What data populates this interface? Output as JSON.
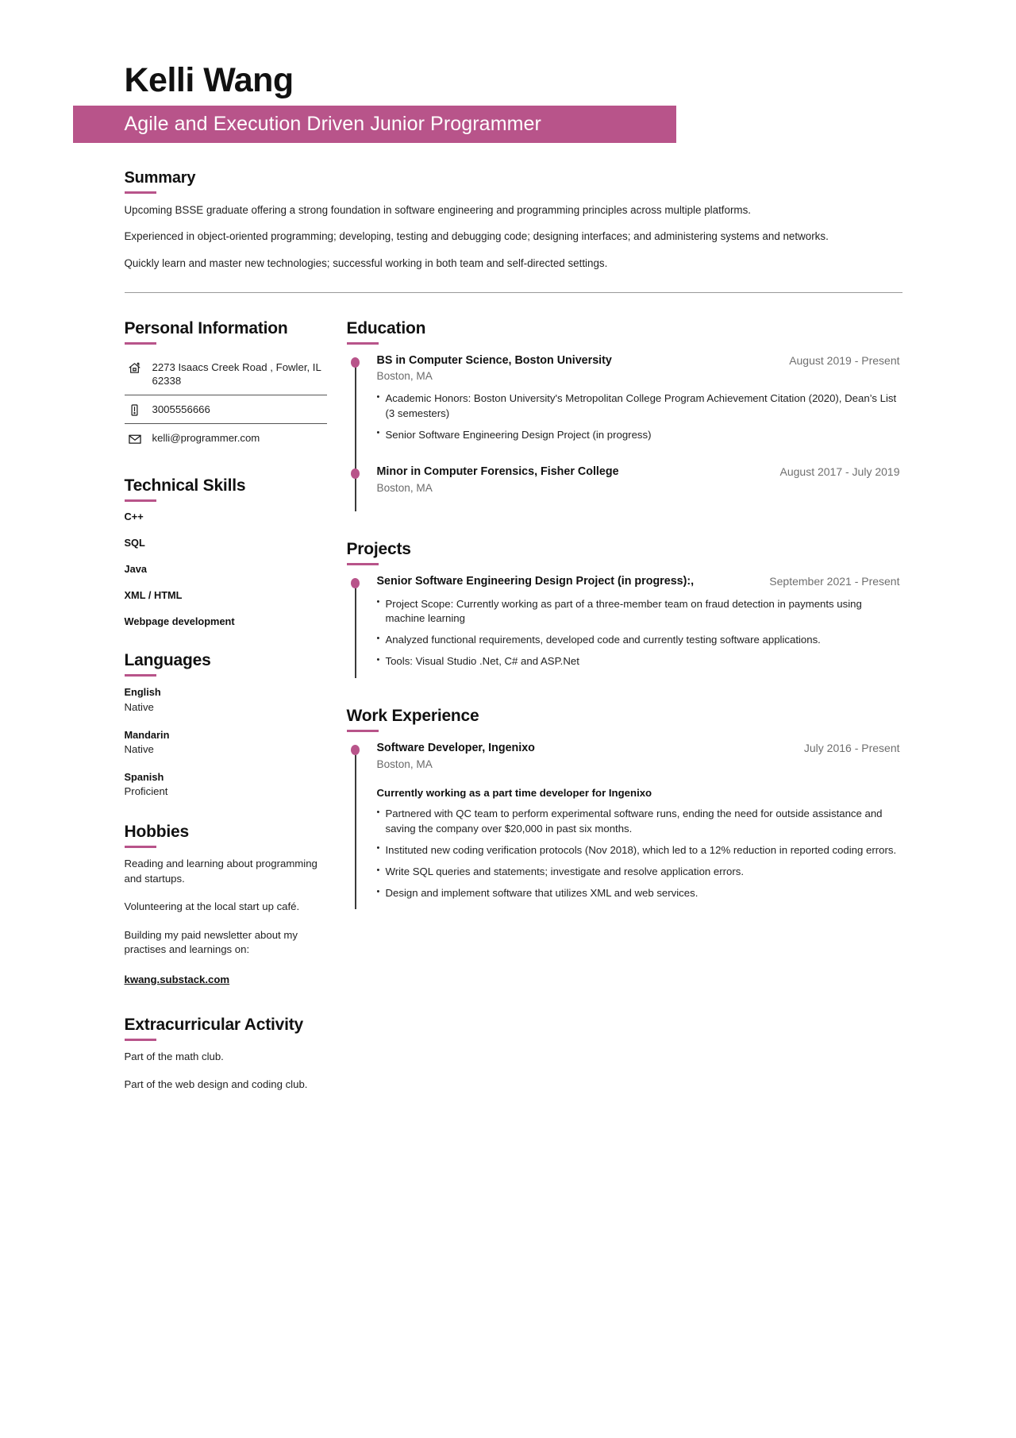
{
  "header": {
    "name": "Kelli Wang",
    "title": "Agile and Execution Driven Junior Programmer"
  },
  "colors": {
    "accent": "#b8548a",
    "text": "#1f1f1f",
    "muted": "#6a6a6a"
  },
  "summary": {
    "heading": "Summary",
    "paragraphs": [
      "Upcoming BSSE graduate offering a strong foundation in software engineering and programming principles across multiple platforms.",
      "Experienced in object-oriented programming; developing, testing and debugging code; designing interfaces; and administering systems and networks.",
      "Quickly learn and master new technologies; successful working in both team and self-directed settings."
    ]
  },
  "personal_information": {
    "heading": "Personal Information",
    "items": [
      {
        "icon": "home-icon",
        "value": "2273 Isaacs Creek Road , Fowler, IL 62338"
      },
      {
        "icon": "phone-icon",
        "value": "3005556666"
      },
      {
        "icon": "email-icon",
        "value": "kelli@programmer.com"
      }
    ]
  },
  "technical_skills": {
    "heading": "Technical Skills",
    "items": [
      "C++",
      "SQL",
      "Java",
      "XML / HTML",
      "Webpage development"
    ]
  },
  "languages": {
    "heading": "Languages",
    "items": [
      {
        "name": "English",
        "level": "Native"
      },
      {
        "name": "Mandarin",
        "level": "Native"
      },
      {
        "name": "Spanish",
        "level": "Proficient"
      }
    ]
  },
  "hobbies": {
    "heading": "Hobbies",
    "paragraphs": [
      "Reading and learning about programming and startups.",
      "Volunteering at the local start up café.",
      "Building my paid newsletter about my practises and learnings on:"
    ],
    "link": "kwang.substack.com"
  },
  "extracurricular": {
    "heading": "Extracurricular Activity",
    "paragraphs": [
      "Part of the math club.",
      "Part of the web design and coding club."
    ]
  },
  "education": {
    "heading": "Education",
    "entries": [
      {
        "title": "BS in Computer Science, Boston University",
        "location": "Boston, MA",
        "date": "August 2019 - Present",
        "bullets": [
          "Academic Honors: Boston University's Metropolitan College Program Achievement Citation (2020), Dean’s List (3 semesters)",
          "Senior Software Engineering Design Project (in progress)"
        ]
      },
      {
        "title": "Minor in Computer Forensics, Fisher College",
        "location": "Boston, MA",
        "date": "August 2017 - July 2019",
        "bullets": []
      }
    ]
  },
  "projects": {
    "heading": "Projects",
    "entries": [
      {
        "title": "Senior Software Engineering Design Project (in progress):,",
        "location": "",
        "date": "September 2021 - Present",
        "bullets": [
          "Project Scope: Currently working as part of a three-member team on fraud detection in payments using machine learning",
          "Analyzed functional requirements, developed code and currently testing software applications.",
          "Tools: Visual Studio .Net, C# and ASP.Net"
        ]
      }
    ]
  },
  "work_experience": {
    "heading": "Work Experience",
    "entries": [
      {
        "title": "Software Developer, Ingenixo",
        "location": "Boston, MA",
        "date": "July 2016 - Present",
        "note": "Currently working as a part time developer for Ingenixo",
        "bullets": [
          "Partnered with QC team to perform experimental software runs, ending the need for outside assistance and saving the company over $20,000 in past six months.",
          "Instituted new coding verification protocols (Nov 2018), which led to a 12% reduction in reported coding errors.",
          "Write SQL queries and statements; investigate and resolve application errors.",
          "Design and implement software that utilizes XML and web services."
        ]
      }
    ]
  }
}
